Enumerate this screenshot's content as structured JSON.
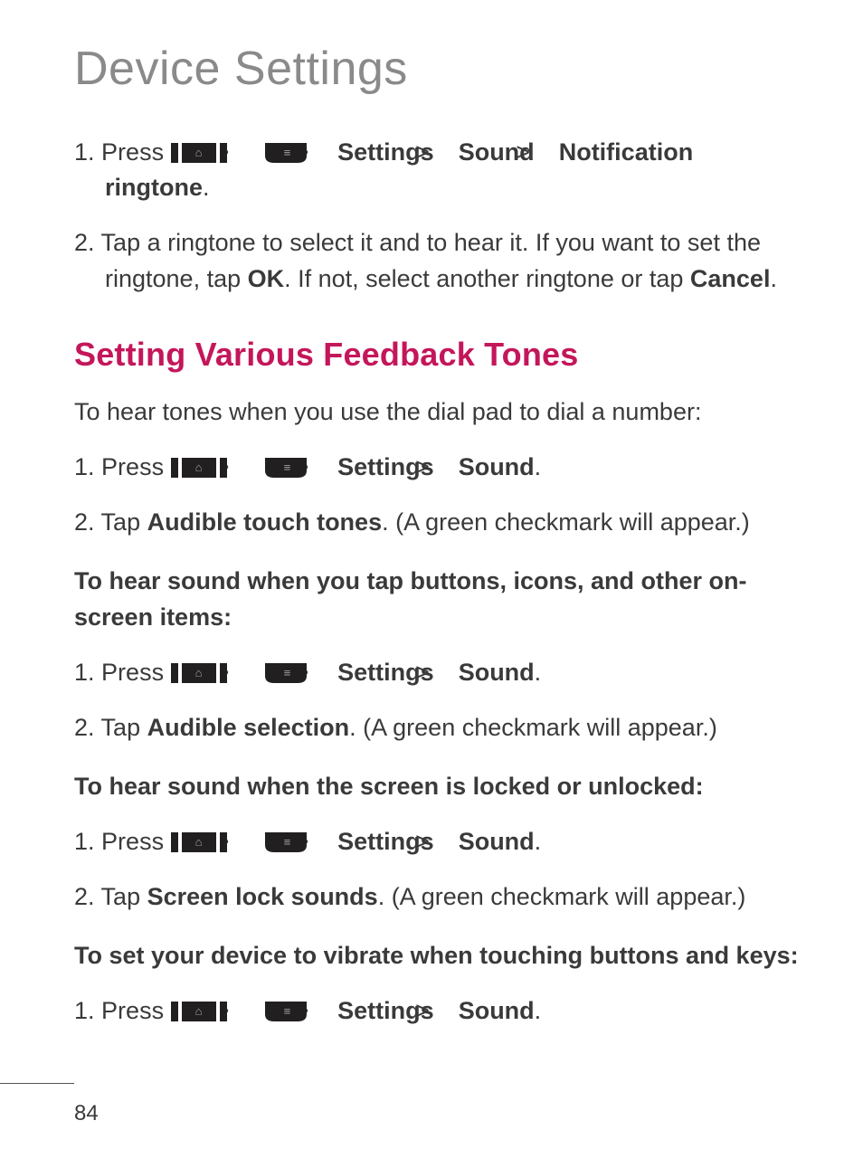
{
  "page_title": "Device Settings",
  "page_number": "84",
  "intro_steps": [
    {
      "num": "1.",
      "lead": "Press ",
      "tail_parts": [
        "Settings",
        "Sound",
        "Notification ringtone"
      ],
      "final_punct": "."
    },
    {
      "num": "2.",
      "text_a": "Tap a ringtone to select it and to hear it. If you want to set the ringtone, tap ",
      "bold_a": "OK",
      "text_b": ". If not, select another ringtone or tap ",
      "bold_b": "Cancel",
      "text_c": "."
    }
  ],
  "section_heading": "Setting Various Feedback Tones",
  "section_intro": "To hear tones when you use the dial pad to dial a number:",
  "sec1_steps": [
    {
      "num": "1.",
      "lead": "Press ",
      "tail_parts": [
        "Settings",
        "Sound"
      ],
      "final_punct": "."
    },
    {
      "num": "2.",
      "text_a": "Tap ",
      "bold_a": "Audible touch tones",
      "text_b": ". (A green checkmark will appear.)"
    }
  ],
  "sub2_heading": "To hear sound when you tap buttons, icons, and other on-screen items:",
  "sec2_steps": [
    {
      "num": "1.",
      "lead": " Press ",
      "tail_parts": [
        "Settings",
        "Sound"
      ],
      "final_punct": "."
    },
    {
      "num": "2.",
      "text_a": "Tap ",
      "bold_a": "Audible selection",
      "text_b": ". (A green checkmark will appear.)"
    }
  ],
  "sub3_heading": "To hear sound when the screen is locked or unlocked:",
  "sec3_steps": [
    {
      "num": "1.",
      "lead": "Press ",
      "tail_parts": [
        "Settings",
        "Sound"
      ],
      "final_punct": "."
    },
    {
      "num": "2.",
      "text_a": "Tap ",
      "bold_a": "Screen lock sounds",
      "text_b": ". (A green checkmark will appear.)"
    }
  ],
  "sub4_heading": "To set your device to vibrate when touching buttons and keys:",
  "sec4_steps": [
    {
      "num": "1.",
      "lead": "Press ",
      "tail_parts": [
        "Settings",
        "Sound"
      ],
      "final_punct": "."
    }
  ],
  "nav_sep": ">",
  "icons": {
    "home_glyph": "⌂",
    "menu_glyph": "≡"
  }
}
